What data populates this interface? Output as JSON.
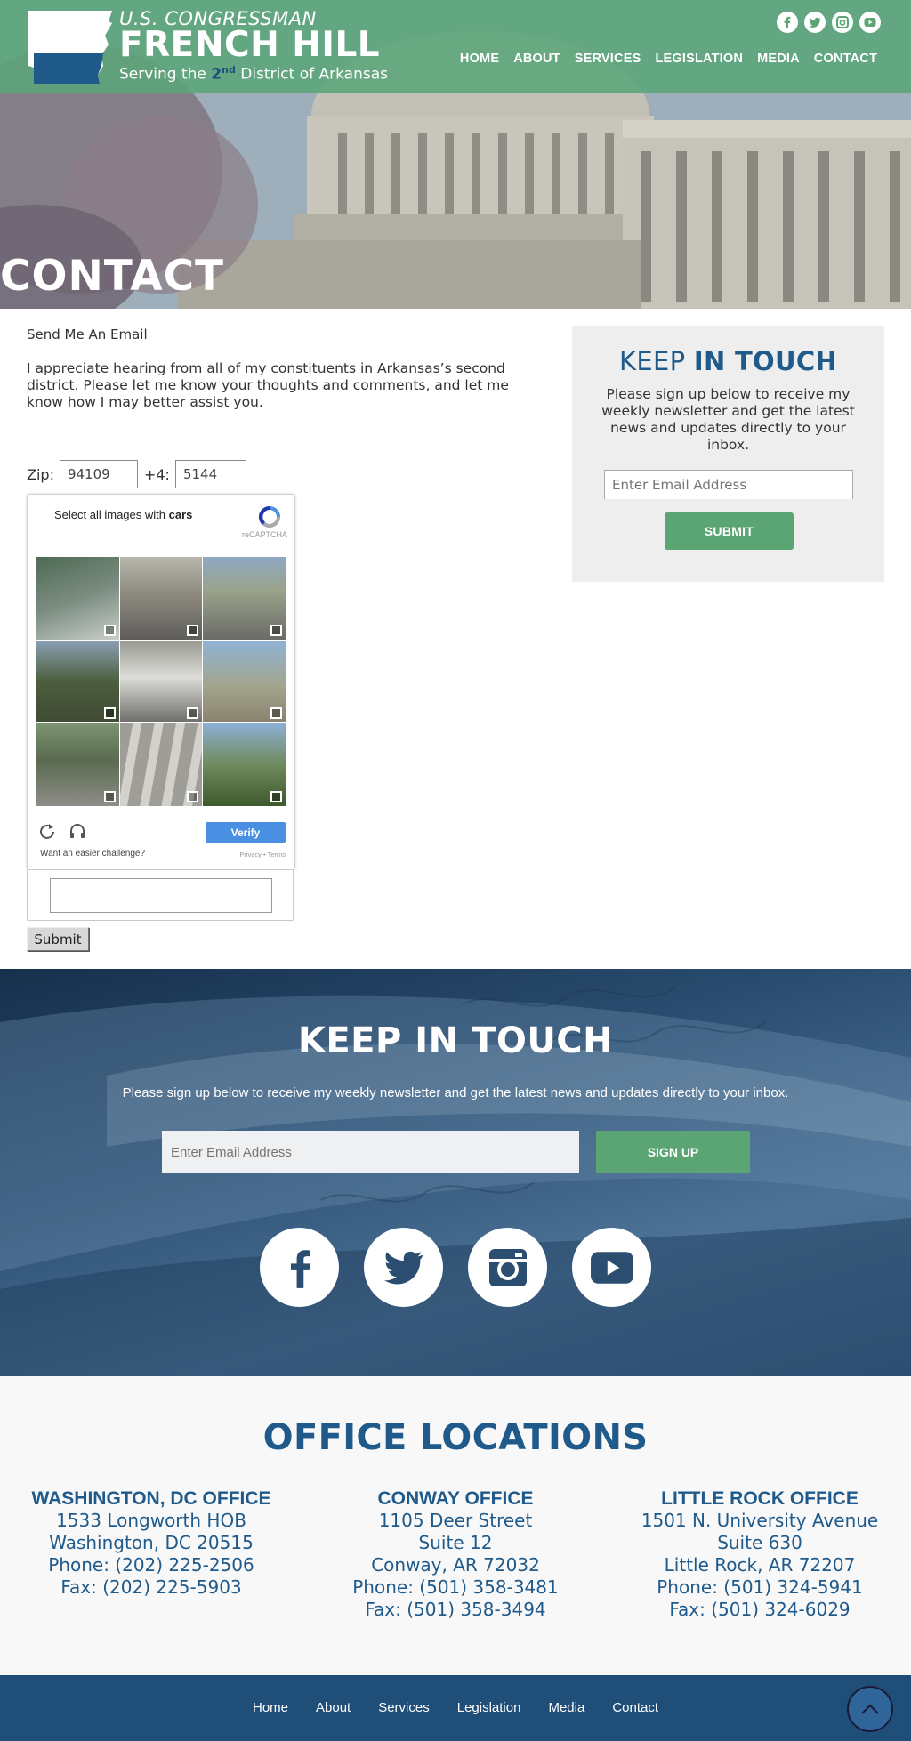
{
  "header": {
    "logo_line1": "U.S. CONGRESSMAN",
    "logo_line2": "FRENCH HILL",
    "logo_line3_pre": "Serving the ",
    "logo_line3_num": "2",
    "logo_line3_sup": "nd",
    "logo_line3_post": " District of Arkansas",
    "social_icons": [
      "facebook-icon",
      "twitter-icon",
      "instagram-icon",
      "youtube-icon"
    ],
    "nav": [
      "HOME",
      "ABOUT",
      "SERVICES",
      "LEGISLATION",
      "MEDIA",
      "CONTACT"
    ]
  },
  "hero": {
    "title": "CONTACT"
  },
  "form": {
    "heading": "Send Me An Email",
    "intro": "I appreciate hearing from all of my constituents in Arkansas’s second district. Please let me know your thoughts and comments, and let me know how I may better assist you.",
    "zip_label": "Zip:",
    "zip_value": "94109",
    "plus4_label": "+4:",
    "plus4_value": "5144",
    "submit_label": "Submit"
  },
  "captcha": {
    "prompt_pre": "Select all images with ",
    "prompt_target": "cars",
    "brand": "reCAPTCHA",
    "verify_label": "Verify",
    "easier_link": "Want an easier challenge?",
    "terms": "Privacy • Terms"
  },
  "sidebar": {
    "title_light": "KEEP ",
    "title_bold": "IN TOUCH",
    "text": "Please sign up below to receive my weekly newsletter and get the latest news and updates directly to your inbox.",
    "email_placeholder": "Enter Email Address",
    "submit_label": "SUBMIT"
  },
  "newsletter": {
    "title_light": "KEEP IN ",
    "title_bold": "TOUCH",
    "text": "Please sign up below to receive my weekly newsletter and get the latest news and updates directly to your inbox.",
    "email_placeholder": "Enter Email Address",
    "signup_label": "SIGN UP",
    "social_icons": [
      "facebook-icon",
      "twitter-icon",
      "instagram-icon",
      "youtube-icon"
    ]
  },
  "offices": {
    "title_light": "OFFICE ",
    "title_bold": "LOCATIONS",
    "list": [
      {
        "name": "WASHINGTON, DC OFFICE",
        "lines": [
          "1533 Longworth HOB",
          "Washington, DC 20515",
          "Phone: (202) 225-2506",
          "Fax: (202) 225-5903"
        ]
      },
      {
        "name": "CONWAY OFFICE",
        "lines": [
          "1105 Deer Street",
          "Suite 12",
          "Conway, AR 72032",
          "Phone: (501) 358-3481",
          "Fax: (501) 358-3494"
        ]
      },
      {
        "name": "LITTLE ROCK OFFICE",
        "lines": [
          "1501 N. University Avenue",
          "Suite 630",
          "Little Rock, AR 72207",
          "Phone: (501) 324-5941",
          "Fax: (501) 324-6029"
        ]
      }
    ]
  },
  "footer": {
    "nav": [
      "Home",
      "About",
      "Services",
      "Legislation",
      "Media",
      "Contact"
    ]
  },
  "colors": {
    "brand_green": "#5aa573",
    "brand_blue": "#1f5a8b",
    "footer_blue": "#1f4e79",
    "captcha_blue": "#4a90e2"
  }
}
